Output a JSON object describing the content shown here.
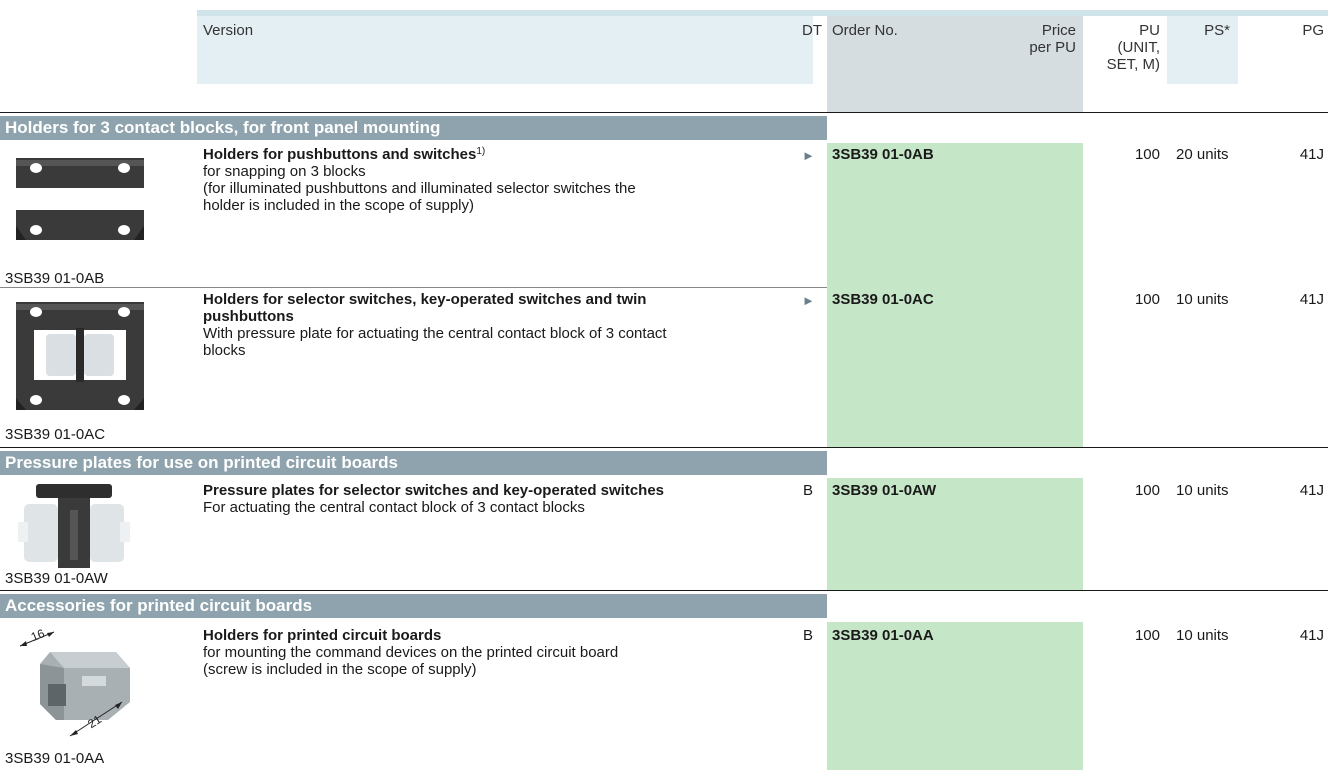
{
  "header": {
    "version": "Version",
    "dt": "DT",
    "order_no": "Order No.",
    "price_line1": "Price",
    "price_line2": "per PU",
    "pu_line1": "PU",
    "pu_line2": "(UNIT,",
    "pu_line3": "SET, M)",
    "ps": "PS*",
    "pg": "PG"
  },
  "sections": [
    {
      "title": "Holders for 3 contact blocks, for front panel mounting",
      "rows": [
        {
          "image_caption": "3SB39 01-0AB",
          "title": "Holders for pushbuttons and switches",
          "footnote": "1)",
          "desc1": "for snapping on 3 blocks",
          "desc2": "(for illuminated pushbuttons and illuminated selector switches the",
          "desc3": "holder is included in the scope of supply)",
          "dt": "►",
          "order_no": "3SB39 01-0AB",
          "pu": "100",
          "ps": "20 units",
          "pg": "41J"
        },
        {
          "image_caption": "3SB39 01-0AC",
          "title1": "Holders for selector switches, key-operated switches and twin",
          "title2": "pushbuttons",
          "desc1": "With pressure plate for actuating the central contact block of 3 contact",
          "desc2": "blocks",
          "dt": "►",
          "order_no": "3SB39 01-0AC",
          "pu": "100",
          "ps": "10 units",
          "pg": "41J"
        }
      ]
    },
    {
      "title": "Pressure plates for use on printed circuit boards",
      "rows": [
        {
          "image_caption": "3SB39 01-0AW",
          "title": "Pressure plates for selector switches and key-operated switches",
          "desc1": "For actuating the central contact block of 3 contact blocks",
          "dt": "B",
          "order_no": "3SB39 01-0AW",
          "pu": "100",
          "ps": "10 units",
          "pg": "41J"
        }
      ]
    },
    {
      "title": "Accessories for printed circuit boards",
      "rows": [
        {
          "image_caption": "3SB39 01-0AA",
          "title": "Holders for printed circuit boards",
          "desc1": "for mounting the command devices on the printed circuit board",
          "desc2": "(screw is included in the scope of supply)",
          "dt": "B",
          "order_no": "3SB39 01-0AA",
          "pu": "100",
          "ps": "10 units",
          "pg": "41J",
          "dim1": "16",
          "dim2": "21"
        }
      ]
    }
  ]
}
